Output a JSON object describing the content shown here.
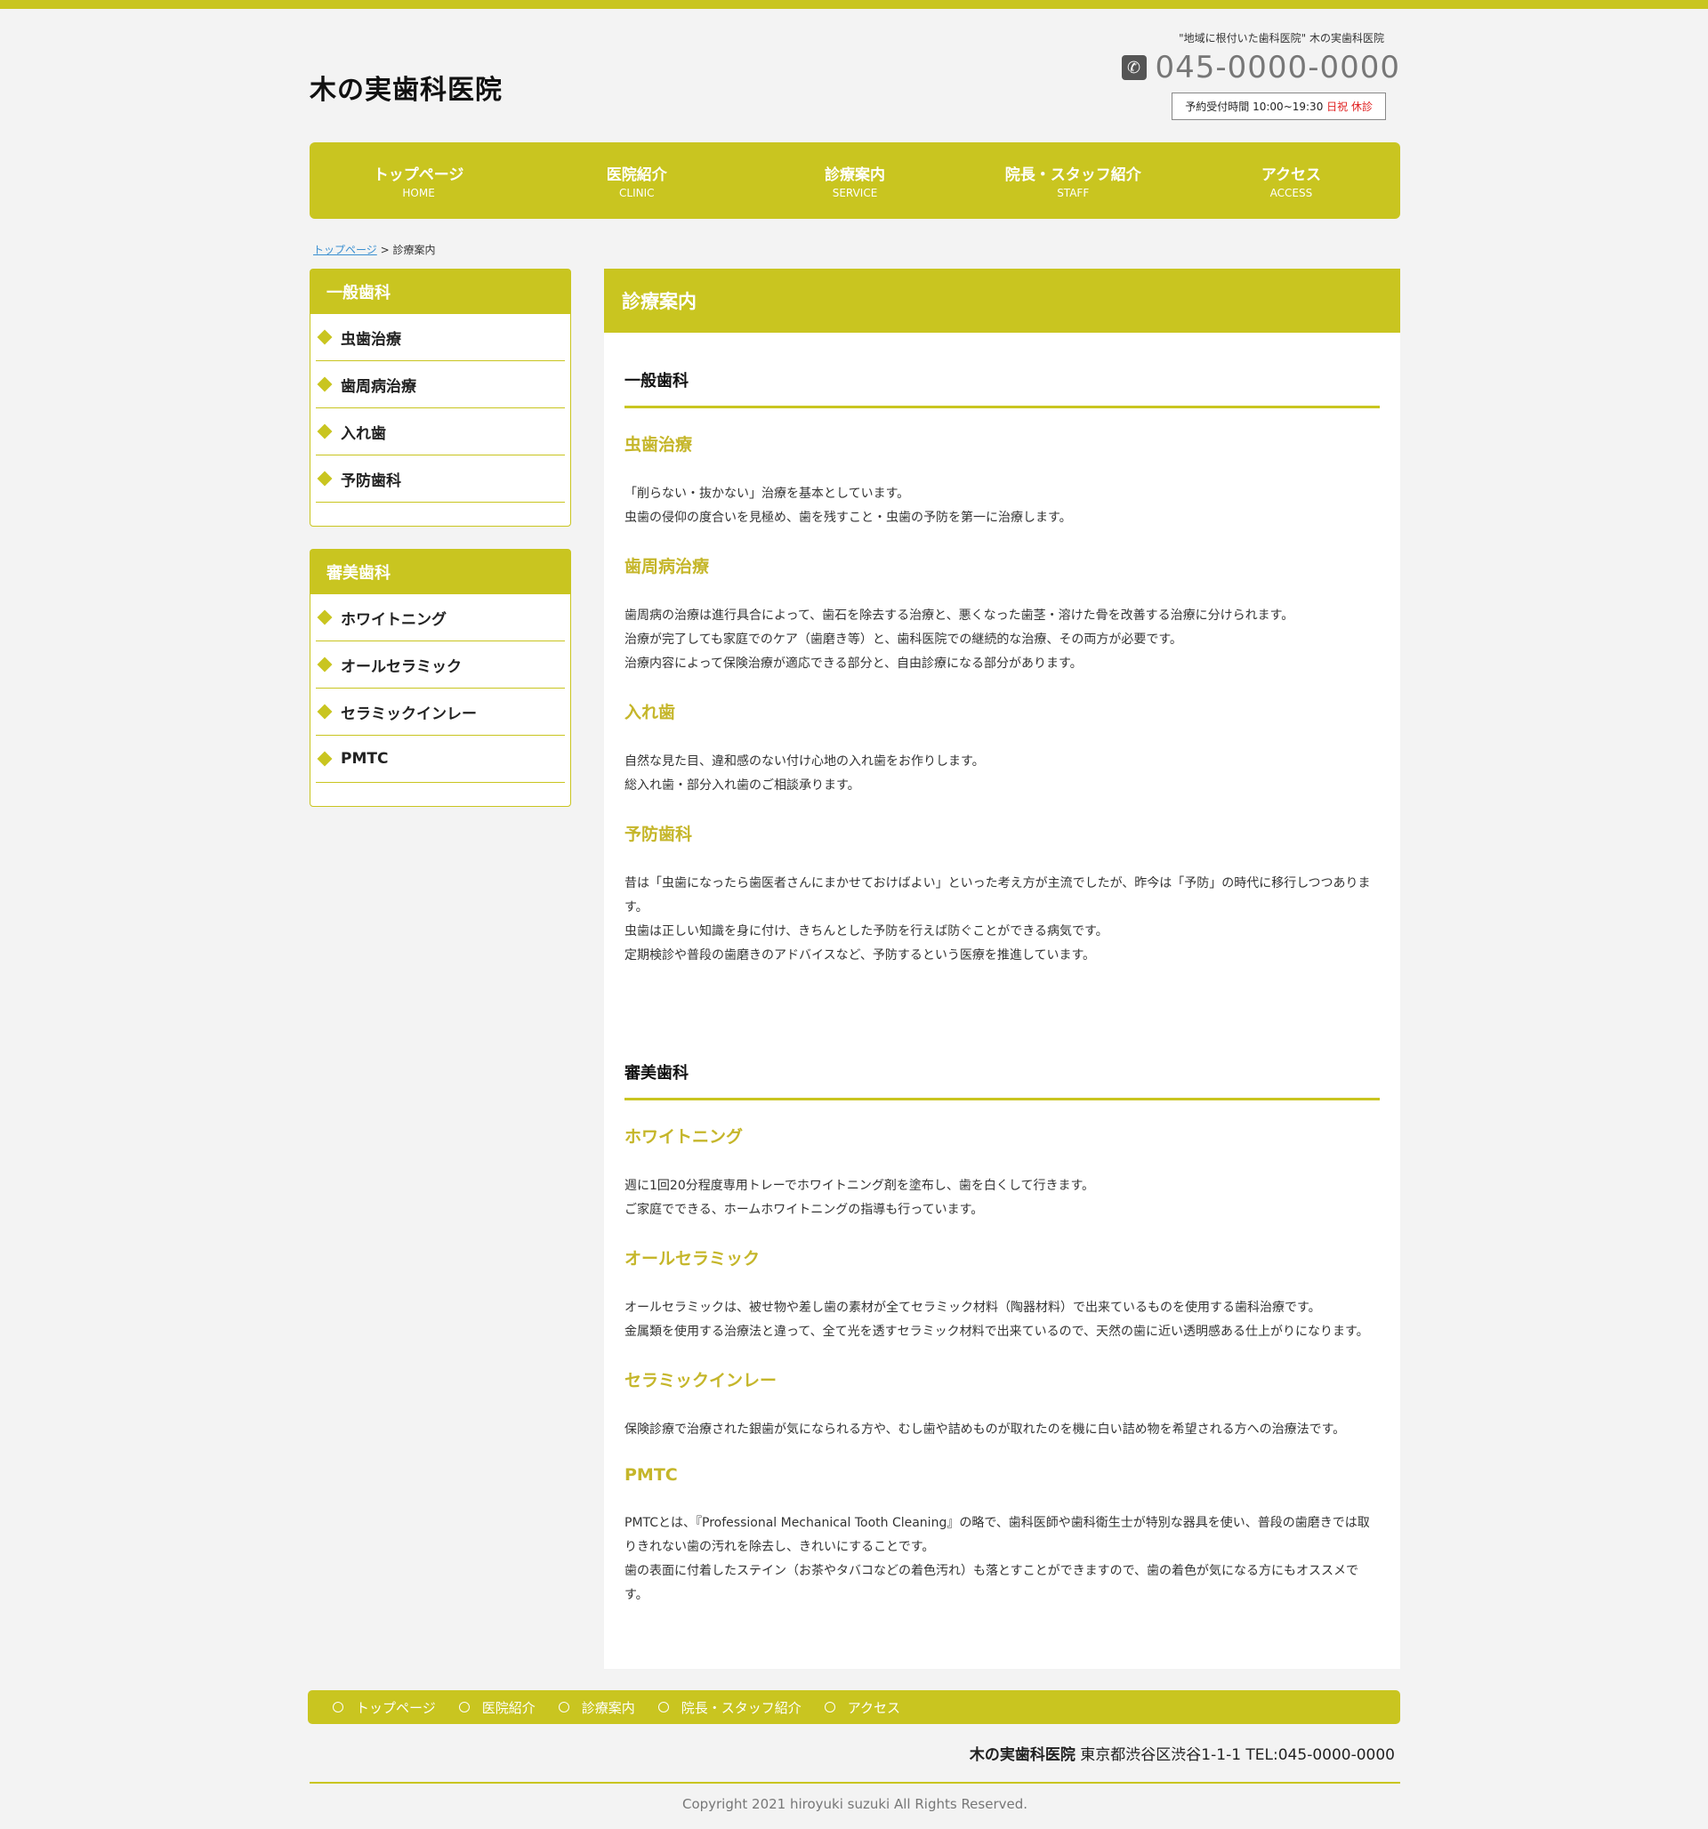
{
  "header": {
    "site_title": "木の実歯科医院",
    "tagline": "\"地域に根付いた歯科医院\" 木の実歯科医院",
    "phone": "045-0000-0000",
    "hours_label": "予約受付時間 10:00~19:30",
    "hours_closed": "日祝 休診",
    "phone_icon": "phone-icon"
  },
  "nav": {
    "items": [
      {
        "jp": "トップページ",
        "en": "HOME"
      },
      {
        "jp": "医院紹介",
        "en": "CLINIC"
      },
      {
        "jp": "診療案内",
        "en": "SERVICE"
      },
      {
        "jp": "院長・スタッフ紹介",
        "en": "STAFF"
      },
      {
        "jp": "アクセス",
        "en": "ACCESS"
      }
    ]
  },
  "breadcrumb": {
    "home": "トップページ",
    "sep": ">",
    "current": "診療案内"
  },
  "sidebar": {
    "general": {
      "title": "一般歯科",
      "items": [
        "虫歯治療",
        "歯周病治療",
        "入れ歯",
        "予防歯科"
      ]
    },
    "cosmetic": {
      "title": "審美歯科",
      "items": [
        "ホワイトニング",
        "オールセラミック",
        "セラミックインレー",
        "PMTC"
      ]
    }
  },
  "main": {
    "title": "診療案内",
    "sections": [
      {
        "title": "一般歯科",
        "subs": [
          {
            "title": "虫歯治療",
            "lines": [
              "「削らない・抜かない」治療を基本としています。",
              "虫歯の侵仰の度合いを見極め、歯を残すこと・虫歯の予防を第一に治療します。"
            ]
          },
          {
            "title": "歯周病治療",
            "lines": [
              "歯周病の治療は進行具合によって、歯石を除去する治療と、悪くなった歯茎・溶けた骨を改善する治療に分けられます。",
              "治療が完了しても家庭でのケア（歯磨き等）と、歯科医院での継続的な治療、その両方が必要です。",
              "治療内容によって保険治療が適応できる部分と、自由診療になる部分があります。"
            ]
          },
          {
            "title": "入れ歯",
            "lines": [
              "自然な見た目、違和感のない付け心地の入れ歯をお作りします。",
              "総入れ歯・部分入れ歯のご相談承ります。"
            ]
          },
          {
            "title": "予防歯科",
            "lines": [
              "昔は「虫歯になったら歯医者さんにまかせておけばよい」といった考え方が主流でしたが、昨今は「予防」の時代に移行しつつあります。",
              "虫歯は正しい知識を身に付け、きちんとした予防を行えば防ぐことができる病気です。",
              "定期検診や普段の歯磨きのアドバイスなど、予防するという医療を推進しています。"
            ]
          }
        ]
      },
      {
        "title": "審美歯科",
        "subs": [
          {
            "title": "ホワイトニング",
            "lines": [
              "週に1回20分程度専用トレーでホワイトニング剤を塗布し、歯を白くして行きます。",
              "ご家庭でできる、ホームホワイトニングの指導も行っています。"
            ]
          },
          {
            "title": "オールセラミック",
            "lines": [
              "オールセラミックは、被せ物や差し歯の素材が全てセラミック材料（陶器材料）で出来ているものを使用する歯科治療です。",
              "金属類を使用する治療法と違って、全て光を透すセラミック材料で出来ているので、天然の歯に近い透明感ある仕上がりになります。"
            ]
          },
          {
            "title": "セラミックインレー",
            "lines": [
              "保険診療で治療された銀歯が気になられる方や、むし歯や詰めものが取れたのを機に白い詰め物を希望される方への治療法です。"
            ]
          },
          {
            "title": "PMTC",
            "lines": [
              "PMTCとは、『Professional Mechanical Tooth Cleaning』の略で、歯科医師や歯科衛生士が特別な器具を使い、普段の歯磨きでは取りきれない歯の汚れを除去し、きれいにすることです。",
              "歯の表面に付着したステイン（お茶やタバコなどの着色汚れ）も落とすことができますので、歯の着色が気になる方にもオススメです。"
            ]
          }
        ]
      }
    ]
  },
  "footer": {
    "nav": [
      "トップページ",
      "医院紹介",
      "診療案内",
      "院長・スタッフ紹介",
      "アクセス"
    ],
    "clinic_name": "木の実歯科医院",
    "address": "東京都渋谷区渋谷1-1-1 TEL:045-0000-0000",
    "copyright": "Copyright 2021 hiroyuki suzuki All Rights Reserved."
  },
  "colors": {
    "accent": "#c9c520",
    "subtitle": "#c5b62a",
    "closed": "#e02020",
    "link": "#3a8fd0"
  }
}
